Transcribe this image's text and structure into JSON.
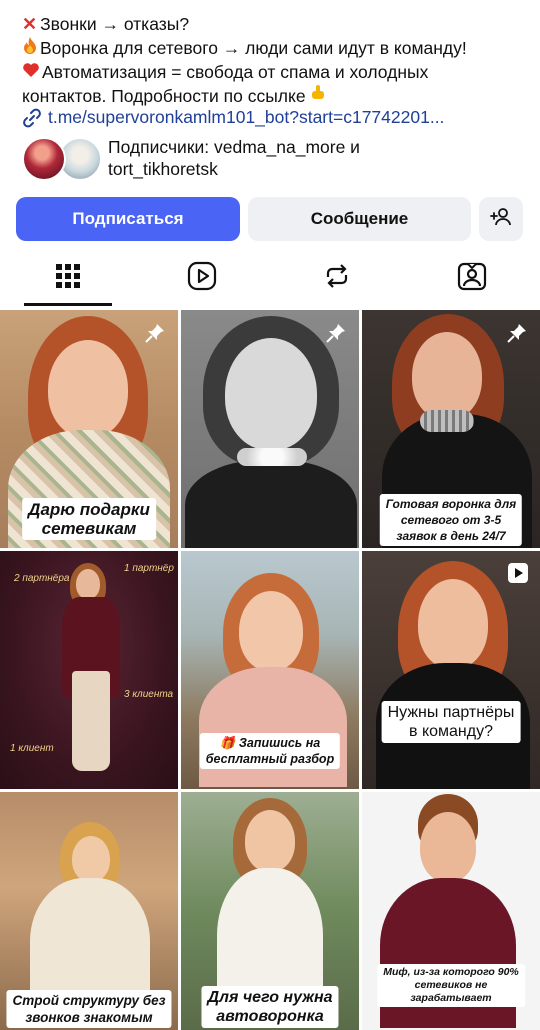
{
  "bio": {
    "line1": "Звонки → отказы?",
    "line2": "Воронка для сетевого → люди сами идут в команду!",
    "line3": "Автоматизация = свобода от спама и холодных",
    "line4": "контактов. Подробности по ссылке"
  },
  "link": {
    "text": "t.me/supervoronkamlm101_bot?start=c17742201..."
  },
  "followers": {
    "line1": "Подписчики: vedma_na_more и",
    "line2": "tort_tikhoretsk"
  },
  "actions": {
    "subscribe": "Подписаться",
    "message": "Сообщение"
  },
  "icons": {
    "bio1": "cross-mark-icon",
    "bio2": "fire-icon",
    "bio3": "heart-icon",
    "bio4": "pointing-down-icon",
    "link": "link-icon",
    "add_user": "add-user-icon",
    "tabs": [
      "grid-icon",
      "reels-icon",
      "reposts-icon",
      "tagged-icon"
    ],
    "pin": "pin-icon",
    "play": "play-icon"
  },
  "colors": {
    "primary_button": "#4a64f5",
    "secondary_button": "#eef0f3",
    "link": "#1f3f99"
  },
  "posts": [
    {
      "caption_l1": "Дарю подарки",
      "caption_l2": "сетевикам",
      "pinned": true
    },
    {
      "caption_l1": "",
      "caption_l2": "",
      "pinned": true
    },
    {
      "caption_l1": "Готовая воронка для",
      "caption_l2": "сетевого от 3-5",
      "caption_l3": "заявок в день 24/7",
      "pinned": true
    },
    {
      "tag1": "2 партнёра",
      "tag2": "1 партнёр",
      "tag3": "3 клиента",
      "tag4": "1 клиент"
    },
    {
      "caption_l1": "🎁 Запишись на",
      "caption_l2": "бесплатный разбор"
    },
    {
      "caption_l1": "Нужны партнёры",
      "caption_l2": "в команду?",
      "reel": true
    },
    {
      "caption_l1": "Строй структуру без",
      "caption_l2": "звонков знакомым"
    },
    {
      "caption_l1": "Для чего нужна",
      "caption_l2": "автоворонка"
    },
    {
      "caption_l1": "Миф, из-за которого 90%",
      "caption_l2": "сетевиков не",
      "caption_l3": "зарабатывает"
    }
  ]
}
